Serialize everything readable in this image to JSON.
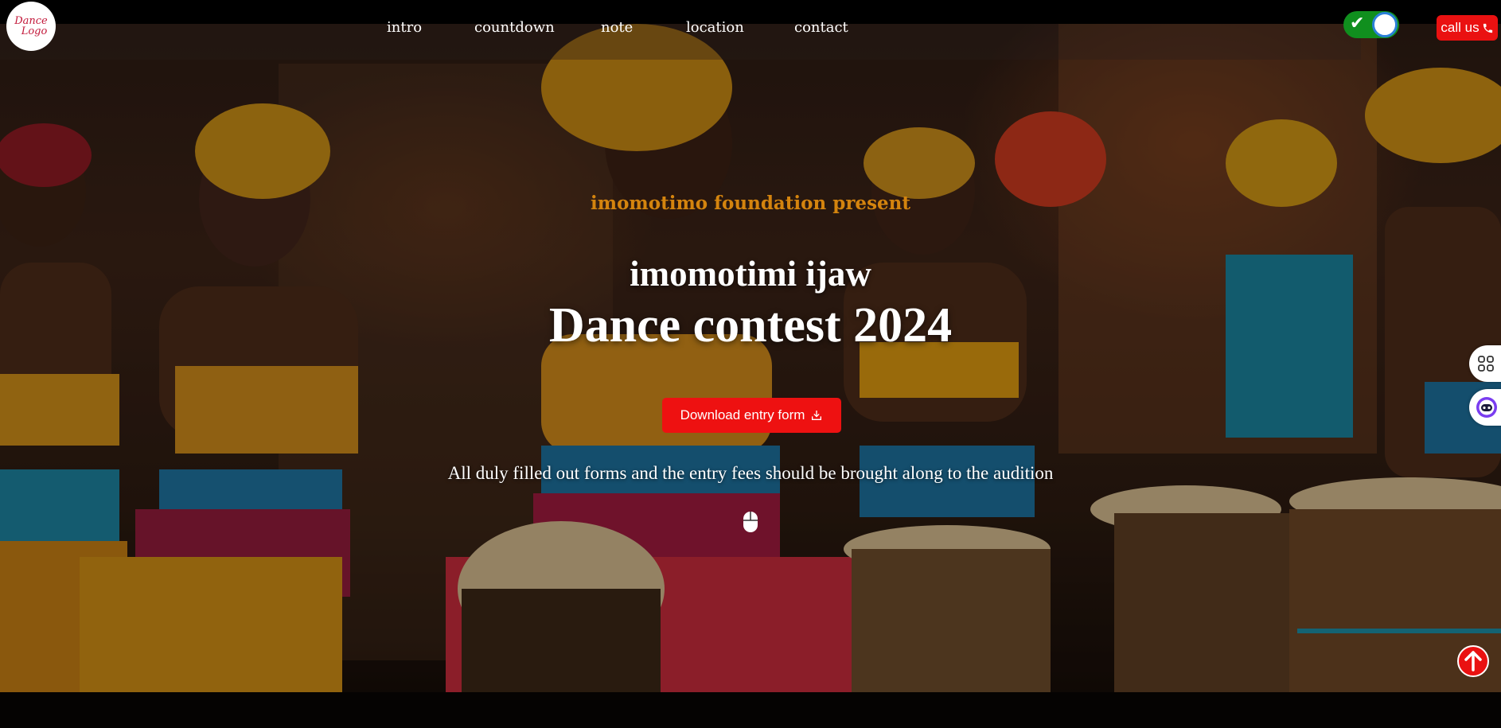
{
  "header": {
    "logo_line1": "Dance",
    "logo_line2": "Logo",
    "nav": [
      {
        "label": "intro"
      },
      {
        "label": "countdown"
      },
      {
        "label": "note"
      },
      {
        "label": "location"
      },
      {
        "label": "contact"
      }
    ],
    "theme_toggle_on": true,
    "call_label": "call us"
  },
  "hero": {
    "presenter": "imomotimo foundation present",
    "title_line1": "imomotimi ijaw",
    "title_line2": "Dance contest 2024",
    "download_label": "Download entry form",
    "note": "All duly filled out forms and the entry fees should be brought along to the audition"
  },
  "icons": {
    "call": "phone-icon",
    "download": "download-icon",
    "scroll": "mouse-icon",
    "apps": "apps-grid-icon",
    "assistant": "bot-icon",
    "back_to_top": "arrow-up-icon"
  },
  "colors": {
    "accent_red": "#ea1111",
    "presenter_gold": "#d4840e",
    "toggle_green": "#108f1e"
  }
}
